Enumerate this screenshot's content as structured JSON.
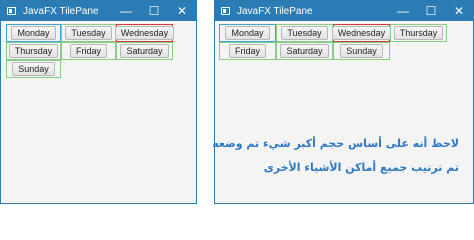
{
  "left_window": {
    "title": "JavaFX TilePane",
    "controls": {
      "minimize": "—",
      "maximize": "☐",
      "close": "✕"
    },
    "buttons": [
      "Monday",
      "Tuesday",
      "Wednesday",
      "Thursday",
      "Friday",
      "Saturday",
      "Sunday"
    ]
  },
  "right_window": {
    "title": "JavaFX TilePane",
    "controls": {
      "minimize": "—",
      "maximize": "☐",
      "close": "✕"
    },
    "buttons": [
      "Monday",
      "Tuesday",
      "Wednesday",
      "Thursday",
      "Friday",
      "Saturday",
      "Sunday"
    ],
    "note_line1": "لاحظ أنه على أساس حجم أكبر شيء تم وضعه",
    "note_line2": "تم ترتيب جميع أماكن الأشياء الأخرى"
  },
  "colors": {
    "titlebar": "#2b7cb5",
    "tile_border": "#88cc88",
    "first_tile_border": "#3aa6d8",
    "largest_tile_border": "#d23a3a",
    "note_text": "#2f78c4"
  }
}
